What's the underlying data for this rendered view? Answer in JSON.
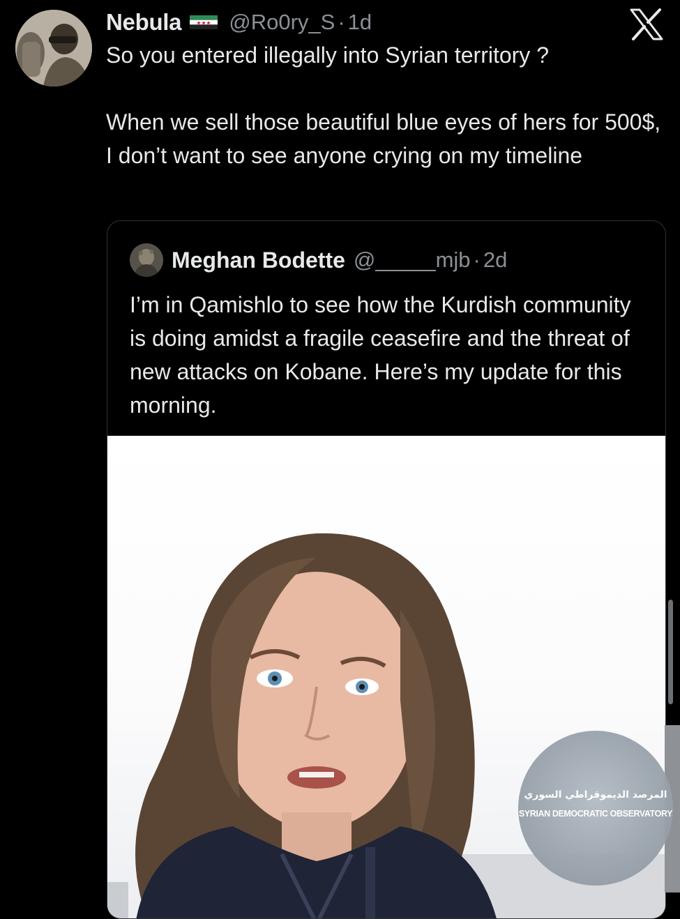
{
  "tweet": {
    "author": {
      "display_name": "Nebula",
      "flag_icon": "syria-revolution-flag-icon",
      "handle": "@Ro0ry_S",
      "separator": "·",
      "age": "1d"
    },
    "text_paragraphs": [
      "So you entered illegally into Syrian territory ?",
      "When we sell those beautiful blue eyes of hers for 500$, I don’t want to see anyone crying on my timeline"
    ]
  },
  "quoted_tweet": {
    "author": {
      "display_name": "Meghan Bodette",
      "handle": "@_____mjb",
      "separator": "·",
      "age": "2d"
    },
    "text": "I’m in Qamishlo to see how the Kurdish community is doing amidst a fragile ceasefire and the threat of new attacks on Kobane. Here’s my update for this morning.",
    "media": {
      "type": "video-thumbnail",
      "description_icon": "person-video-frame"
    }
  },
  "watermark": {
    "arabic": "المرصد الديموقراطي السوري",
    "english": "SYRIAN DEMOCRATIC OBSERVATORY"
  },
  "icons": {
    "platform_logo": "x-logo-icon"
  },
  "colors": {
    "background": "#000000",
    "text_primary": "#e7e9ea",
    "text_secondary": "#8b9096",
    "card_border": "#2f3336"
  }
}
